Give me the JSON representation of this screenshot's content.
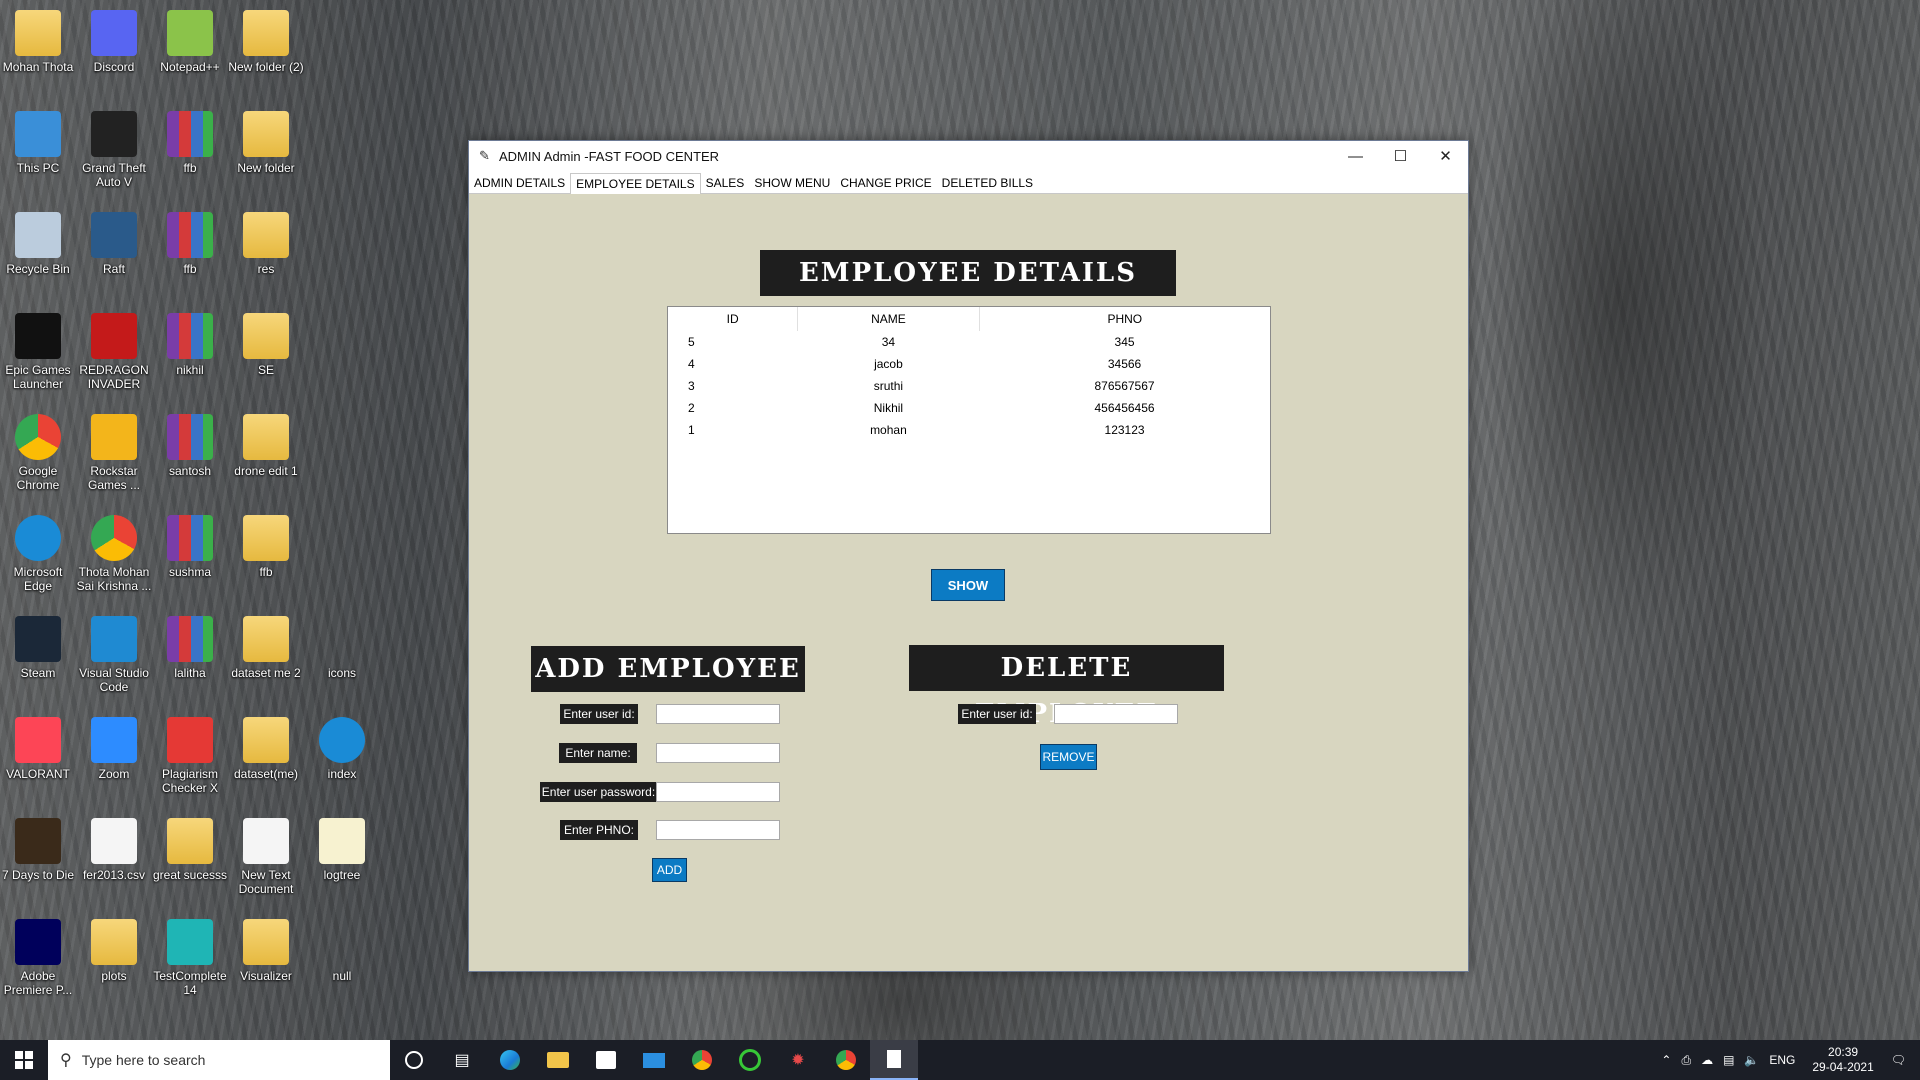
{
  "desktop": {
    "icons": [
      {
        "label": "Mohan Thota",
        "icon": "user-folder-icon",
        "col": 0,
        "row": 0
      },
      {
        "label": "Discord",
        "icon": "discord-icon",
        "col": 1,
        "row": 0
      },
      {
        "label": "Notepad++",
        "icon": "notepadpp-icon",
        "col": 2,
        "row": 0
      },
      {
        "label": "New folder (2)",
        "icon": "folder-icon",
        "col": 3,
        "row": 0
      },
      {
        "label": "This PC",
        "icon": "computer-icon",
        "col": 0,
        "row": 1
      },
      {
        "label": "Grand Theft Auto V",
        "icon": "gta-icon",
        "col": 1,
        "row": 1
      },
      {
        "label": "ffb",
        "icon": "winrar-icon",
        "col": 2,
        "row": 1
      },
      {
        "label": "New folder",
        "icon": "folder-icon",
        "col": 3,
        "row": 1
      },
      {
        "label": "Recycle Bin",
        "icon": "recycle-bin-icon",
        "col": 0,
        "row": 2
      },
      {
        "label": "Raft",
        "icon": "raft-icon",
        "col": 1,
        "row": 2
      },
      {
        "label": "ffb",
        "icon": "winrar-icon",
        "col": 2,
        "row": 2
      },
      {
        "label": "res",
        "icon": "folder-icon",
        "col": 3,
        "row": 2
      },
      {
        "label": "Epic Games Launcher",
        "icon": "epic-games-icon",
        "col": 0,
        "row": 3
      },
      {
        "label": "REDRAGON INVADER",
        "icon": "redragon-icon",
        "col": 1,
        "row": 3
      },
      {
        "label": "nikhil",
        "icon": "winrar-icon",
        "col": 2,
        "row": 3
      },
      {
        "label": "SE",
        "icon": "folder-icon",
        "col": 3,
        "row": 3
      },
      {
        "label": "Google Chrome",
        "icon": "chrome-icon",
        "col": 0,
        "row": 4
      },
      {
        "label": "Rockstar Games ...",
        "icon": "rockstar-icon",
        "col": 1,
        "row": 4
      },
      {
        "label": "santosh",
        "icon": "winrar-icon",
        "col": 2,
        "row": 4
      },
      {
        "label": "drone edit 1",
        "icon": "folder-icon",
        "col": 3,
        "row": 4
      },
      {
        "label": "Microsoft Edge",
        "icon": "edge-icon",
        "col": 0,
        "row": 5
      },
      {
        "label": "Thota Mohan Sai Krishna ...",
        "icon": "chrome-profile-icon",
        "col": 1,
        "row": 5
      },
      {
        "label": "sushma",
        "icon": "winrar-icon",
        "col": 2,
        "row": 5
      },
      {
        "label": "ffb",
        "icon": "folder-icon",
        "col": 3,
        "row": 5
      },
      {
        "label": "Steam",
        "icon": "steam-icon",
        "col": 0,
        "row": 6
      },
      {
        "label": "Visual Studio Code",
        "icon": "vscode-icon",
        "col": 1,
        "row": 6
      },
      {
        "label": "lalitha",
        "icon": "winrar-icon",
        "col": 2,
        "row": 6
      },
      {
        "label": "dataset me 2",
        "icon": "folder-icon",
        "col": 3,
        "row": 6
      },
      {
        "label": "icons",
        "icon": "blank-icon",
        "col": 4,
        "row": 6
      },
      {
        "label": "VALORANT",
        "icon": "valorant-icon",
        "col": 0,
        "row": 7
      },
      {
        "label": "Zoom",
        "icon": "zoom-icon",
        "col": 1,
        "row": 7
      },
      {
        "label": "Plagiarism Checker X",
        "icon": "plagiarism-icon",
        "col": 2,
        "row": 7
      },
      {
        "label": "dataset(me)",
        "icon": "folder-icon",
        "col": 3,
        "row": 7
      },
      {
        "label": "index",
        "icon": "edge-icon",
        "col": 4,
        "row": 7
      },
      {
        "label": "7 Days to Die",
        "icon": "game-icon",
        "col": 0,
        "row": 8
      },
      {
        "label": "fer2013.csv",
        "icon": "file-icon",
        "col": 1,
        "row": 8
      },
      {
        "label": "great sucesss",
        "icon": "folder-icon",
        "col": 2,
        "row": 8
      },
      {
        "label": "New Text Document",
        "icon": "text-file-icon",
        "col": 3,
        "row": 8
      },
      {
        "label": "logtree",
        "icon": "python-file-icon",
        "col": 4,
        "row": 8
      },
      {
        "label": "Adobe Premiere P...",
        "icon": "premiere-icon",
        "col": 0,
        "row": 9
      },
      {
        "label": "plots",
        "icon": "folder-icon",
        "col": 1,
        "row": 9
      },
      {
        "label": "TestComplete 14",
        "icon": "testcomplete-icon",
        "col": 2,
        "row": 9
      },
      {
        "label": "Visualizer",
        "icon": "folder-icon",
        "col": 3,
        "row": 9
      },
      {
        "label": "null",
        "icon": "blank-icon",
        "col": 4,
        "row": 9
      }
    ]
  },
  "window": {
    "title": "ADMIN Admin -FAST FOOD CENTER",
    "tabs": [
      "ADMIN DETAILS",
      "EMPLOYEE DETAILS",
      "SALES",
      "SHOW MENU",
      "CHANGE PRICE",
      "DELETED BILLS"
    ],
    "active_tab": "EMPLOYEE DETAILS",
    "heading": "EMPLOYEE DETAILS",
    "table": {
      "columns": [
        "ID",
        "NAME",
        "PHNO"
      ],
      "rows": [
        [
          "5",
          "34",
          "345"
        ],
        [
          "4",
          "jacob",
          "34566"
        ],
        [
          "3",
          "sruthi",
          "876567567"
        ],
        [
          "2",
          "Nikhil",
          "456456456"
        ],
        [
          "1",
          "mohan",
          "123123"
        ]
      ]
    },
    "show_button": "SHOW",
    "add": {
      "heading": "ADD EMPLOYEE",
      "user_id_label": "Enter user id:",
      "name_label": "Enter name:",
      "password_label": "Enter user password:",
      "phno_label": "Enter PHNO:",
      "button": "ADD"
    },
    "delete": {
      "heading": "DELETE EMPLOYEE",
      "user_id_label": "Enter user id:",
      "button": "REMOVE"
    }
  },
  "taskbar": {
    "search_placeholder": "Type here to search",
    "language": "ENG",
    "time": "20:39",
    "date": "29-04-2021"
  }
}
